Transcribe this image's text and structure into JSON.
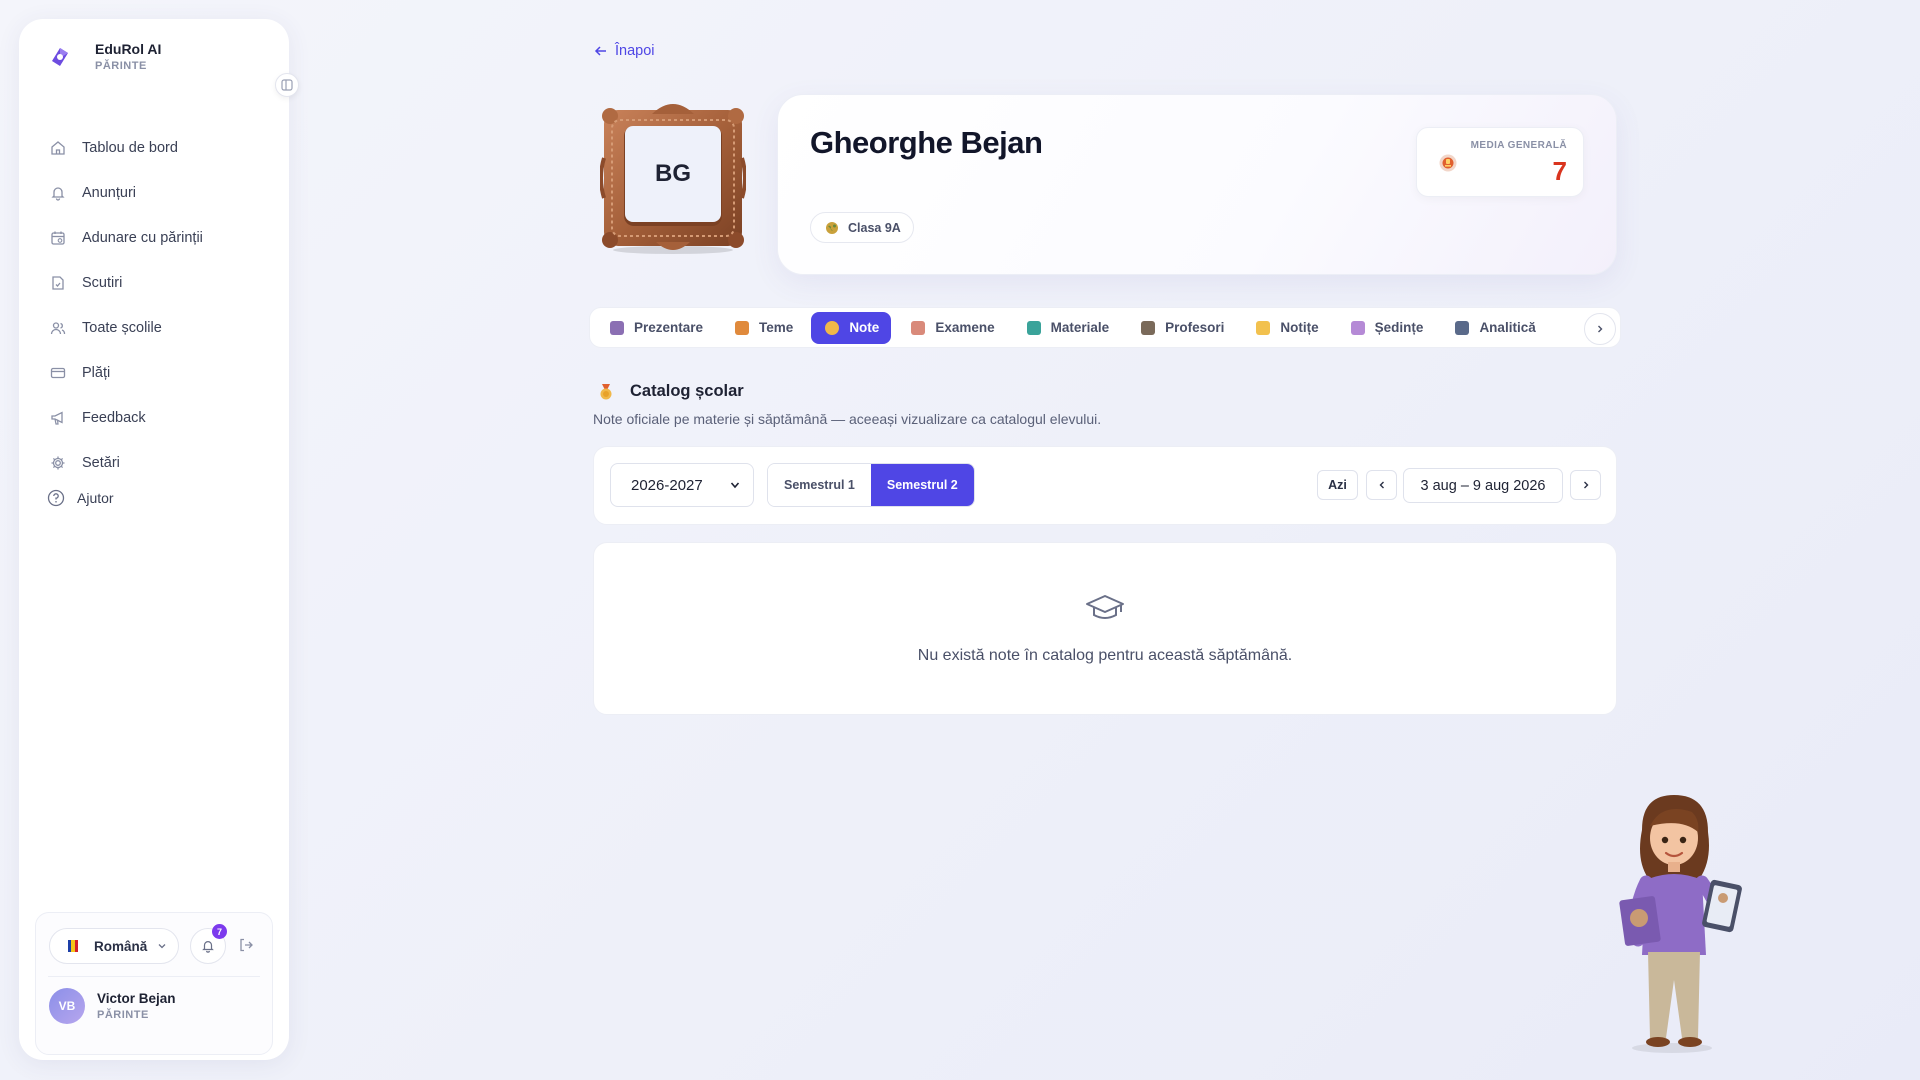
{
  "sidebar": {
    "brand_title": "EduRol AI",
    "brand_role": "PĂRINTE",
    "items": [
      {
        "label": "Tablou de bord",
        "icon": "home-icon"
      },
      {
        "label": "Anunțuri",
        "icon": "bell-icon"
      },
      {
        "label": "Adunare cu părinții",
        "icon": "calendar-icon"
      },
      {
        "label": "Scutiri",
        "icon": "document-icon"
      },
      {
        "label": "Toate școlile",
        "icon": "users-icon"
      },
      {
        "label": "Plăți",
        "icon": "credit-card-icon"
      },
      {
        "label": "Feedback",
        "icon": "megaphone-icon"
      },
      {
        "label": "Setări",
        "icon": "gear-icon"
      }
    ],
    "help_label": "Ajutor",
    "language": "Română",
    "notification_count": "7",
    "user": {
      "initials": "VB",
      "name": "Victor Bejan",
      "role": "PĂRINTE"
    }
  },
  "back_label": "Înapoi",
  "student": {
    "initials": "BG",
    "name": "Gheorghe Bejan",
    "class_label": "Clasa 9A",
    "average_label": "MEDIA GENERALĂ",
    "average_value": "7"
  },
  "tabs": [
    {
      "label": "Prezentare",
      "color": "#8b6fb3"
    },
    {
      "label": "Teme",
      "color": "#e08a3c"
    },
    {
      "label": "Note",
      "color": "#f0b84a",
      "active": true
    },
    {
      "label": "Examene",
      "color": "#d98a7a"
    },
    {
      "label": "Materiale",
      "color": "#3aa39a"
    },
    {
      "label": "Profesori",
      "color": "#7a6a5a"
    },
    {
      "label": "Notițe",
      "color": "#f2c14e"
    },
    {
      "label": "Ședințe",
      "color": "#b58ad6"
    },
    {
      "label": "Analitică",
      "color": "#5a6a8a"
    }
  ],
  "catalog": {
    "title": "Catalog școlar",
    "subtitle": "Note oficiale pe materie și săptămână — aceeași vizualizare ca catalogul elevului.",
    "year": "2026-2027",
    "semester_1": "Semestrul 1",
    "semester_2": "Semestrul 2",
    "today_label": "Azi",
    "week_range": "3 aug – 9 aug 2026",
    "empty_message": "Nu există note în catalog pentru această săptămână."
  },
  "colors": {
    "accent": "#4f46e5",
    "average": "#d9341e",
    "badge": "#7c3aed"
  }
}
